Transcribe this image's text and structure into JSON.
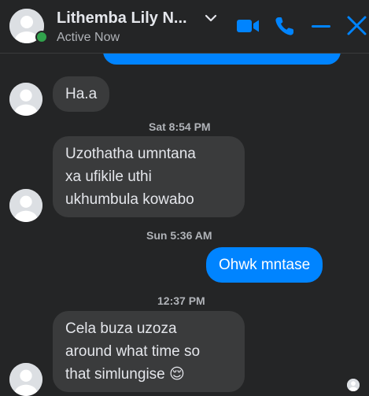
{
  "header": {
    "contact_name": "Lithemba Lily N...",
    "status": "Active Now",
    "icons": [
      "avatar",
      "chevron-down-icon",
      "video-call-icon",
      "phone-icon",
      "minimize-icon",
      "close-icon"
    ],
    "accent_color": "#0084ff",
    "online_color": "#31a24c"
  },
  "messages": [
    {
      "direction": "incoming",
      "text": "Ha.a"
    },
    {
      "timestamp": "Sat 8:54 PM"
    },
    {
      "direction": "incoming",
      "lines": [
        "Uzothatha umntana",
        "xa ufikile uthi",
        "ukhumbula kowabo"
      ]
    },
    {
      "timestamp": "Sun 5:36 AM"
    },
    {
      "direction": "outgoing",
      "text": "Ohwk mntase"
    },
    {
      "timestamp": "12:37 PM"
    },
    {
      "direction": "incoming",
      "lines": [
        "Cela buza uzoza",
        "around what time so",
        "that simlungise 😌"
      ]
    }
  ],
  "colors": {
    "background": "#242526",
    "incoming_bubble": "#3a3b3c",
    "outgoing_bubble": "#0084ff",
    "text": "#e4e6eb",
    "muted": "#b0b3b8"
  }
}
